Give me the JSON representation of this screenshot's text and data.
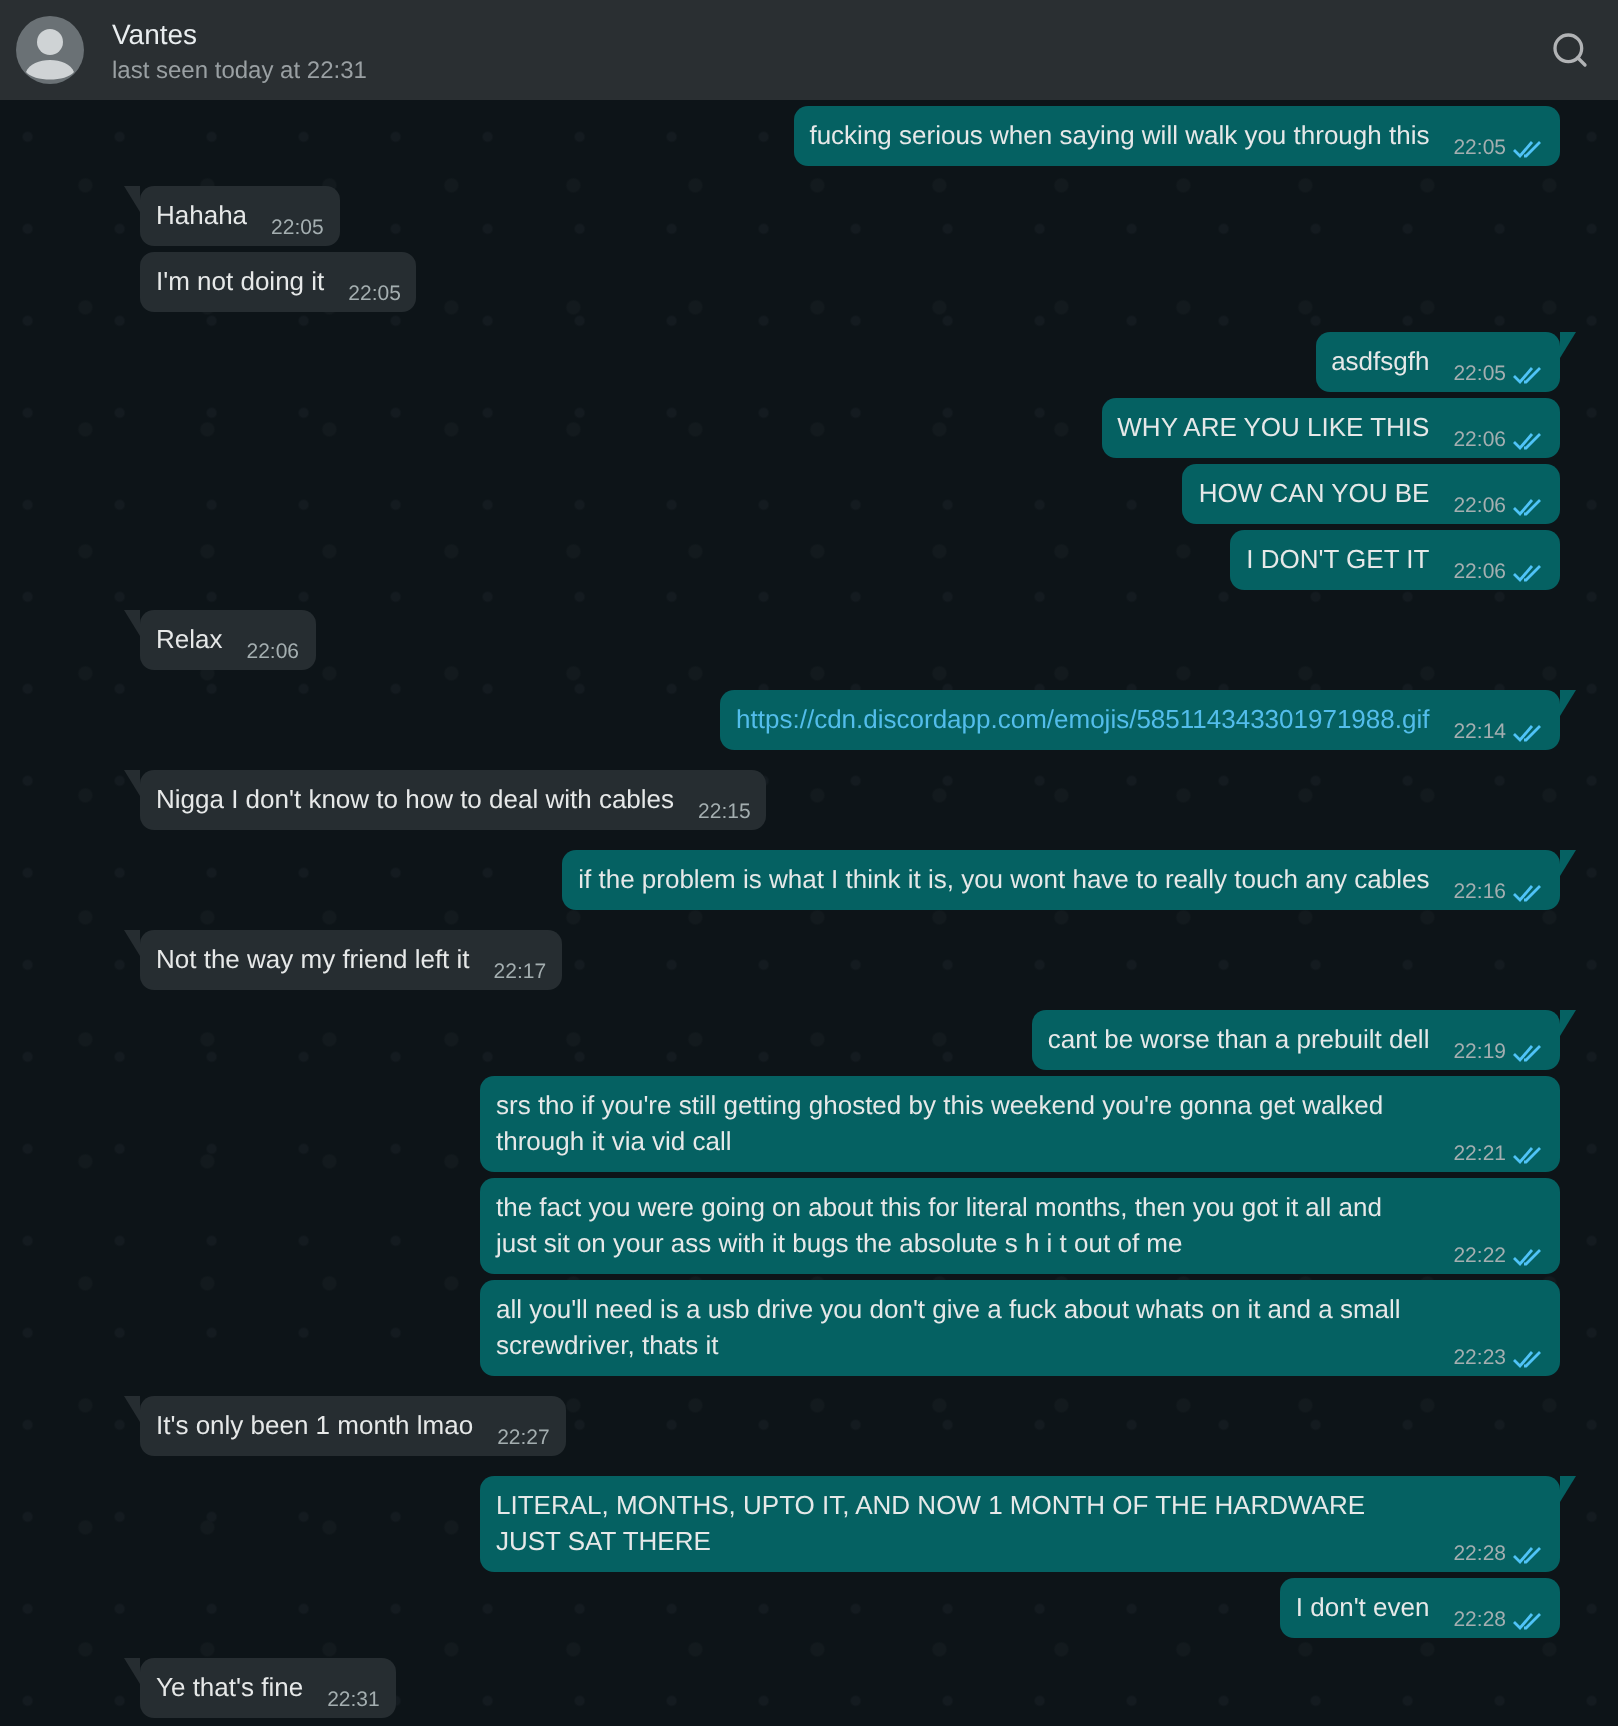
{
  "header": {
    "contact_name": "Vantes",
    "status": "last seen today at 22:31"
  },
  "messages": [
    {
      "outgoing": true,
      "kind": "text",
      "text": "fucking serious when saying will walk you through this",
      "time": "22:05",
      "read": true,
      "first": false
    },
    {
      "outgoing": false,
      "kind": "text",
      "text": "Hahaha",
      "time": "22:05",
      "first": true
    },
    {
      "outgoing": false,
      "kind": "text",
      "text": "I'm not doing it",
      "time": "22:05",
      "first": false
    },
    {
      "outgoing": true,
      "kind": "text",
      "text": "asdfsgfh",
      "time": "22:05",
      "read": true,
      "first": true
    },
    {
      "outgoing": true,
      "kind": "text",
      "text": "WHY ARE YOU LIKE THIS",
      "time": "22:06",
      "read": true,
      "first": false
    },
    {
      "outgoing": true,
      "kind": "text",
      "text": "HOW CAN YOU BE",
      "time": "22:06",
      "read": true,
      "first": false
    },
    {
      "outgoing": true,
      "kind": "text",
      "text": "I DON'T GET IT",
      "time": "22:06",
      "read": true,
      "first": false
    },
    {
      "outgoing": false,
      "kind": "text",
      "text": "Relax",
      "time": "22:06",
      "first": true
    },
    {
      "outgoing": true,
      "kind": "link",
      "text": "https://cdn.discordapp.com/emojis/585114343301971988.gif",
      "time": "22:14",
      "read": true,
      "first": true
    },
    {
      "outgoing": false,
      "kind": "text",
      "text": "Nigga I don't know to how to deal with cables",
      "time": "22:15",
      "first": true
    },
    {
      "outgoing": true,
      "kind": "text",
      "text": "if the problem is what I think it is, you wont have to really touch any cables",
      "time": "22:16",
      "read": true,
      "first": true
    },
    {
      "outgoing": false,
      "kind": "text",
      "text": "Not the way my friend left it",
      "time": "22:17",
      "first": true
    },
    {
      "outgoing": true,
      "kind": "text",
      "text": "cant be worse than a prebuilt dell",
      "time": "22:19",
      "read": true,
      "first": true
    },
    {
      "outgoing": true,
      "kind": "text",
      "text": "srs tho if you're still getting ghosted by this weekend you're gonna get walked through it via vid call",
      "time": "22:21",
      "read": true,
      "first": false
    },
    {
      "outgoing": true,
      "kind": "text",
      "text": "the fact you were going on about this for literal months, then you got it all and just sit on your ass with it bugs the absolute s h i t out of me",
      "time": "22:22",
      "read": true,
      "first": false
    },
    {
      "outgoing": true,
      "kind": "text",
      "text": "all you'll need is a usb drive you don't give a fuck about whats on it and a small screwdriver, thats it",
      "time": "22:23",
      "read": true,
      "first": false
    },
    {
      "outgoing": false,
      "kind": "text",
      "text": "It's only been 1 month lmao",
      "time": "22:27",
      "first": true
    },
    {
      "outgoing": true,
      "kind": "text",
      "text": "LITERAL, MONTHS, UPTO IT, AND NOW 1 MONTH OF THE HARDWARE JUST SAT THERE",
      "time": "22:28",
      "read": true,
      "first": true
    },
    {
      "outgoing": true,
      "kind": "text",
      "text": "I don't even",
      "time": "22:28",
      "read": true,
      "first": false
    },
    {
      "outgoing": false,
      "kind": "text",
      "text": "Ye that's fine",
      "time": "22:31",
      "first": true
    }
  ]
}
